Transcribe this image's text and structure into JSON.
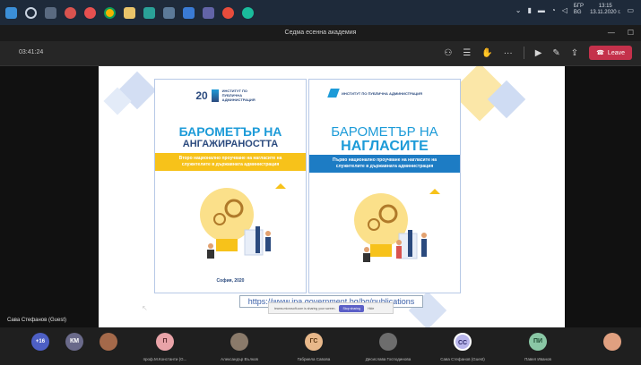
{
  "taskbar": {
    "icons": [
      "start-icon",
      "search-icon",
      "task-view-icon",
      "app-icon-1",
      "app-icon-2",
      "chrome-icon",
      "app-icon-3",
      "app-icon-4",
      "app-icon-5",
      "app-icon-6",
      "teams-icon",
      "app-icon-7",
      "app-icon-8"
    ],
    "tray": {
      "lang_top": "БГР",
      "lang_bottom": "BG",
      "time": "13:15",
      "date": "13.11.2020 г."
    }
  },
  "window": {
    "title": "Седма есенна академия"
  },
  "toolbar": {
    "timer": "03:41:24",
    "leave_label": "Leave"
  },
  "slide": {
    "left_book": {
      "logo_number": "20",
      "logo_text": "ИНСТИТУТ ПО ПУБЛИЧНА АДМИНИСТРАЦИЯ",
      "title_line1": "БАРОМЕТЪР НА",
      "title_line2": "АНГАЖИРАНОСТТА",
      "band_text": "Второ национално проучване на нагласите на служителите в държавната администрация",
      "city": "София, 2020"
    },
    "right_book": {
      "logo_text": "ИНСТИТУТ ПО ПУБЛИЧНА АДМИНИСТРАЦИЯ",
      "title_line1": "БАРОМЕТЪР НА",
      "title_line2": "НАГЛАСИТЕ",
      "band_text": "Първо национално проучване на нагласите на служителите в държавната администрация"
    },
    "url": "https://www.ipa.government.bg/bg/publications",
    "share_notice": "teams.microsoft.com is sharing your screen.",
    "stop_sharing_label": "Stop sharing",
    "hide_label": "Hide"
  },
  "presenter": {
    "name": "Сава Стефанов (Guest)"
  },
  "participants": [
    {
      "initials": "+16",
      "name": "",
      "color": "#4d5fc4"
    },
    {
      "initials": "КМ",
      "name": "",
      "color": "#6a6a8a"
    },
    {
      "initials": "",
      "name": "",
      "color": "#a4694a"
    },
    {
      "initials": "П",
      "name": "проф.М.Константи (G...",
      "color": "#e9a3a8"
    },
    {
      "initials": "",
      "name": "Александър Вълков",
      "color": "#8a7a6a"
    },
    {
      "initials": "ГС",
      "name": "Габриела Савова",
      "color": "#e8b88a"
    },
    {
      "initials": "",
      "name": "Десислава Господинова",
      "color": "#6d6d6d"
    },
    {
      "initials": "СС",
      "name": "Сава Стефанов (Guest)",
      "color": "#b9b6ec"
    },
    {
      "initials": "ПИ",
      "name": "Павел Иванов",
      "color": "#8ac7a5"
    },
    {
      "initials": "",
      "name": "",
      "color": "#e0a080"
    }
  ]
}
